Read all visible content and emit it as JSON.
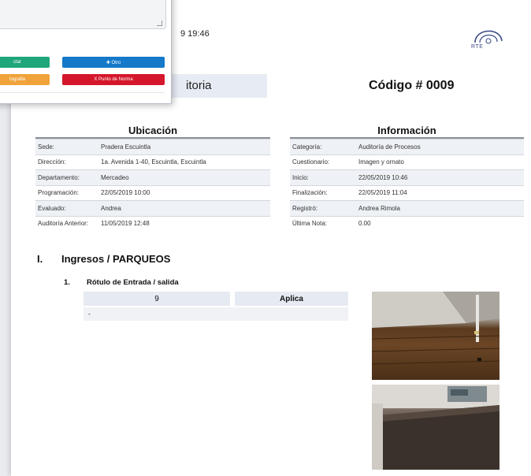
{
  "report": {
    "timestamp": "9 19:46",
    "logo_text": "RTE",
    "title": "itoria",
    "code": "Código # 0009"
  },
  "ubicacion": {
    "heading": "Ubicación",
    "rows": [
      {
        "label": "Sede:",
        "value": "Pradera Escuintla"
      },
      {
        "label": "Dirección:",
        "value": "1a. Avenida 1-40, Escuintla, Escuintla"
      },
      {
        "label": "Departamento:",
        "value": "Mercadeo"
      },
      {
        "label": "Programación:",
        "value": "22/05/2019 10:00"
      },
      {
        "label": "Evaluado:",
        "value": "Andrea"
      },
      {
        "label": "Auditoría Anterior:",
        "value": "11/05/2019 12:48"
      }
    ]
  },
  "informacion": {
    "heading": "Información",
    "rows": [
      {
        "label": "Categoría:",
        "value": "Auditoría de Procesos"
      },
      {
        "label": "Cuestionario:",
        "value": "Imagen y ornato"
      },
      {
        "label": "Inicio:",
        "value": "22/05/2019 10:46"
      },
      {
        "label": "Finalización:",
        "value": "22/05/2019 11:04"
      },
      {
        "label": "Registró:",
        "value": "Andrea Rimola"
      },
      {
        "label": "Última Nota:",
        "value": "0.00"
      }
    ]
  },
  "section": {
    "roman": "I.",
    "title": "Ingresos / PARQUEOS",
    "item_num": "1.",
    "item_title": "Rótulo de Entrada / salida",
    "score": "9",
    "status": "Aplica",
    "observation": "-"
  },
  "dialog": {
    "buttons": [
      {
        "label": "ctar",
        "color": "#1fa67a"
      },
      {
        "label": "✚ Otro",
        "color": "#1479c9"
      },
      {
        "label": "tografia",
        "color": "#f0a33a"
      },
      {
        "label": "X Punto de Norma",
        "color": "#d4172a"
      }
    ]
  },
  "photos": [
    "wood-floor-photo",
    "desk-photo"
  ]
}
